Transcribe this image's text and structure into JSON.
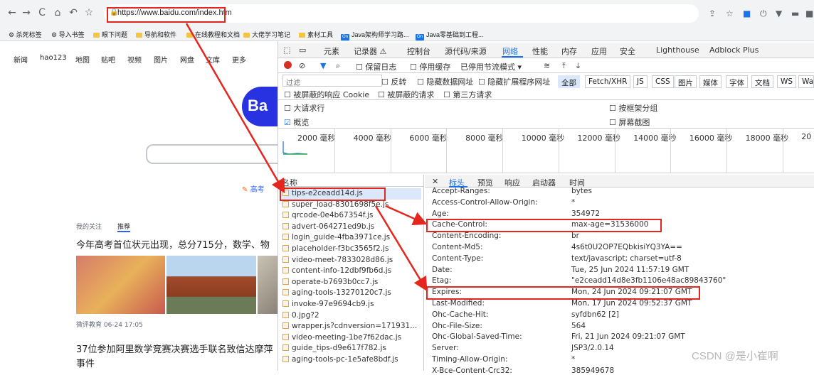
{
  "browser": {
    "url": "https://www.baidu.com/index.htm",
    "bookmarks": [
      {
        "label": "杀死标签",
        "kind": "gear"
      },
      {
        "label": "导入书签",
        "kind": "gear"
      },
      {
        "label": "眼下问题",
        "kind": "folder"
      },
      {
        "label": "导航和软件",
        "kind": "folder"
      },
      {
        "label": "在线教程和文档",
        "kind": "folder"
      },
      {
        "label": "大佬学习笔记",
        "kind": "folder"
      },
      {
        "label": "素材工具",
        "kind": "folder"
      },
      {
        "label": "Java架构师学习路...",
        "kind": "on"
      },
      {
        "label": "Java零基础到工程...",
        "kind": "on"
      }
    ]
  },
  "baidu": {
    "nav": [
      "新闻",
      "hao123",
      "地图",
      "贴吧",
      "视频",
      "图片",
      "网盘",
      "文库",
      "更多"
    ],
    "logo_text": "Ba",
    "gaokao": "高考",
    "tabs": [
      "我的关注",
      "推荐"
    ],
    "news1": "今年高考首位状元出现，总分715分，数学、物",
    "source1": "微评教育  06-24 17:05",
    "news2": "37位参加阿里数学竞赛决赛选手联名致信达摩萍事件"
  },
  "devtools": {
    "top_tabs": [
      "元素",
      "记录器 ⚠",
      "控制台",
      "源代码/来源",
      "网络",
      "性能",
      "内存",
      "应用",
      "安全",
      "Lighthouse",
      "Adblock Plus"
    ],
    "toolbar": {
      "preserve_log": "保留日志",
      "disable_cache": "停用缓存",
      "throttle": "已停用节流模式"
    },
    "filter_placeholder": "过滤",
    "filter_options": [
      "反转",
      "隐藏数据网址",
      "隐藏扩展程序网址"
    ],
    "filter_types": [
      "全部",
      "Fetch/XHR",
      "JS",
      "CSS",
      "图片",
      "媒体",
      "字体",
      "文档",
      "WS",
      "Wa"
    ],
    "row3": [
      "被屏蔽的响应 Cookie",
      "被屏蔽的请求",
      "第三方请求"
    ],
    "opt_left": [
      "大请求行",
      "概览"
    ],
    "opt_right": [
      "按框架分组",
      "屏幕截图"
    ],
    "timeline_labels": [
      "2000 毫秒",
      "4000 毫秒",
      "6000 毫秒",
      "8000 毫秒",
      "10000 毫秒",
      "12000 毫秒",
      "14000 毫秒",
      "16000 毫秒",
      "18000 毫秒",
      "20"
    ],
    "name_header": "名称",
    "files": [
      "tips-e2ceadd14d.js",
      "super_load-8301698f5e.js",
      "qrcode-0e4b67354f.js",
      "advert-064271ed9b.js",
      "login_guide-4fba3971ce.js",
      "placeholder-f3bc3565f2.js",
      "video-meet-7833028d86.js",
      "content-info-12dbf9fb6d.js",
      "operate-b7693b0cc7.js",
      "aging-tools-13270120c7.js",
      "invoke-97e9694cb9.js",
      "0.jpg?2",
      "wrapper.js?cdnversion=171931...",
      "video-meeting-1be7f62dac.js",
      "guide_tips-d9e617f782.js",
      "aging-tools-pc-1e5afe8bdf.js"
    ],
    "detail_tabs": [
      "标头",
      "预览",
      "响应",
      "启动器",
      "时间"
    ],
    "headers": [
      {
        "k": "Accept-Ranges:",
        "v": "bytes"
      },
      {
        "k": "Access-Control-Allow-Origin:",
        "v": "*"
      },
      {
        "k": "Age:",
        "v": "354972"
      },
      {
        "k": "Cache-Control:",
        "v": "max-age=31536000"
      },
      {
        "k": "Content-Encoding:",
        "v": "br"
      },
      {
        "k": "Content-Md5:",
        "v": "4s6t0U2OP7EQbkisiYQ3YA=="
      },
      {
        "k": "Content-Type:",
        "v": "text/javascript; charset=utf-8"
      },
      {
        "k": "Date:",
        "v": "Tue, 25 Jun 2024 11:57:19 GMT"
      },
      {
        "k": "Etag:",
        "v": "\"e2ceadd14d8e3fb1106e48ac89843760\""
      },
      {
        "k": "Expires:",
        "v": "Mon, 24 Jun 2024 09:21:07 GMT"
      },
      {
        "k": "Last-Modified:",
        "v": "Mon, 17 Jun 2024 09:52:37 GMT"
      },
      {
        "k": "Ohc-Cache-Hit:",
        "v": "syfdbn62 [2]"
      },
      {
        "k": "Ohc-File-Size:",
        "v": "564"
      },
      {
        "k": "Ohc-Global-Saved-Time:",
        "v": "Fri, 21 Jun 2024 09:21:07 GMT"
      },
      {
        "k": "Server:",
        "v": "JSP3/2.0.14"
      },
      {
        "k": "Timing-Allow-Origin:",
        "v": "*"
      },
      {
        "k": "X-Bce-Content-Crc32:",
        "v": "385949678"
      }
    ]
  },
  "watermark": "CSDN @是小崔啊",
  "colors": {
    "annotation": "#e5261f",
    "accent": "#1a73e8"
  }
}
